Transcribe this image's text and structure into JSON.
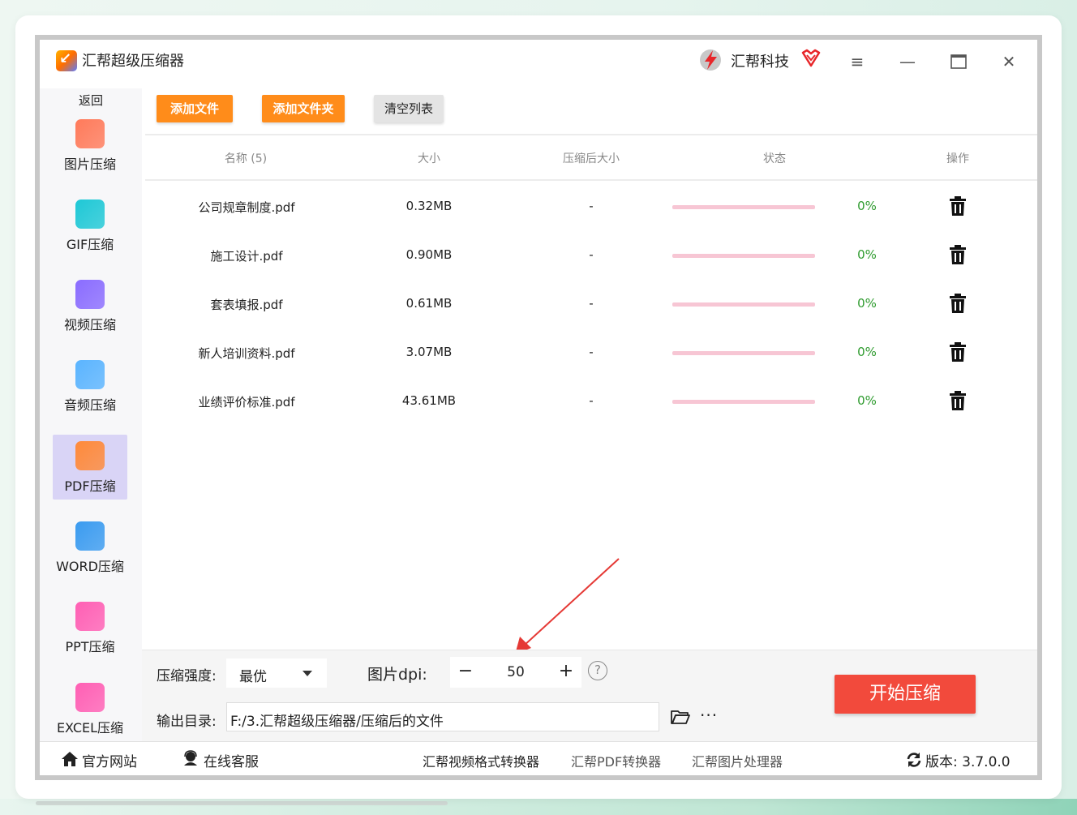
{
  "app": {
    "title": "汇帮超级压缩器",
    "brand": "汇帮科技"
  },
  "window": {
    "menu_icon": "menu-icon",
    "minimize_icon": "minimize-icon",
    "maximize_icon": "maximize-icon",
    "close_icon": "close-icon"
  },
  "sidebar": {
    "back_label": "返回",
    "items": [
      {
        "label": "图片压缩",
        "icon": "image-icon",
        "color": "#ff7a5a",
        "active": false
      },
      {
        "label": "GIF压缩",
        "icon": "gif-icon",
        "color": "#1ec8d6",
        "active": false
      },
      {
        "label": "视频压缩",
        "icon": "video-icon",
        "color": "#8a6cff",
        "active": false
      },
      {
        "label": "音频压缩",
        "icon": "audio-icon",
        "color": "#5ab4ff",
        "active": false
      },
      {
        "label": "PDF压缩",
        "icon": "pdf-icon",
        "color": "#ff8a3a",
        "active": true
      },
      {
        "label": "WORD压缩",
        "icon": "word-icon",
        "color": "#3a9bf0",
        "active": false
      },
      {
        "label": "PPT压缩",
        "icon": "ppt-icon",
        "color": "#ff5fb4",
        "active": false
      },
      {
        "label": "EXCEL压缩",
        "icon": "excel-icon",
        "color": "#ff5fb4",
        "active": false
      }
    ]
  },
  "toolbar": {
    "add_file": "添加文件",
    "add_folder": "添加文件夹",
    "clear_list": "清空列表"
  },
  "table": {
    "headers": {
      "name": "名称 (5)",
      "size": "大小",
      "compressed": "压缩后大小",
      "status": "状态",
      "action": "操作"
    },
    "rows": [
      {
        "name": "公司规章制度.pdf",
        "size": "0.32MB",
        "compressed": "-",
        "progress": "0%"
      },
      {
        "name": "施工设计.pdf",
        "size": "0.90MB",
        "compressed": "-",
        "progress": "0%"
      },
      {
        "name": "套表填报.pdf",
        "size": "0.61MB",
        "compressed": "-",
        "progress": "0%"
      },
      {
        "name": "新人培训资料.pdf",
        "size": "3.07MB",
        "compressed": "-",
        "progress": "0%"
      },
      {
        "name": "业绩评价标准.pdf",
        "size": "43.61MB",
        "compressed": "-",
        "progress": "0%"
      }
    ]
  },
  "controls": {
    "strength_label": "压缩强度:",
    "strength_value": "最优",
    "dpi_label": "图片dpi:",
    "dpi_value": "50",
    "minus": "−",
    "plus": "+",
    "help": "?",
    "output_label": "输出目录:",
    "output_path": "F:/3.汇帮超级压缩器/压缩后的文件",
    "more": "···",
    "start": "开始压缩"
  },
  "footer": {
    "website": "官方网站",
    "service": "在线客服",
    "link1": "汇帮视频格式转换器",
    "link2": "汇帮PDF转换器",
    "link3": "汇帮图片处理器",
    "version": "版本: 3.7.0.0"
  },
  "colors": {
    "accent_orange": "#ff8c1a",
    "start_red": "#f24a3c",
    "progress_green": "#2e9b2e",
    "active_nav": "#d9d4f6"
  }
}
